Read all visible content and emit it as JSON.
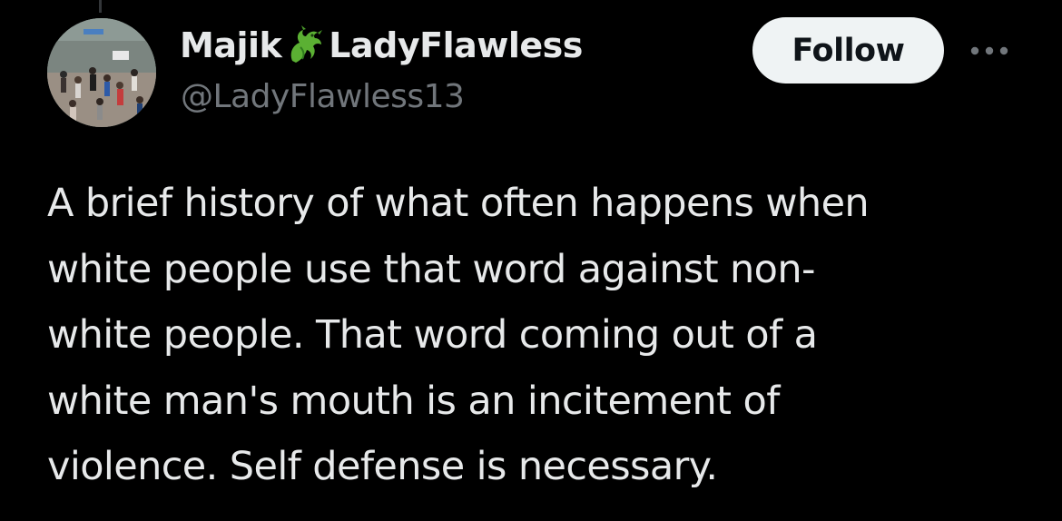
{
  "colors": {
    "background": "#000000",
    "text_primary": "#e7e9ea",
    "text_secondary": "#71767b",
    "follow_bg": "#eff3f4",
    "follow_text": "#0f1419",
    "emoji_green": "#5bb033"
  },
  "author": {
    "name_first": "Majik",
    "name_emoji": "dragon-emoji",
    "name_second": "LadyFlawless",
    "handle": "@LadyFlawless13",
    "avatar_icon": "avatar-photo-crowd"
  },
  "actions": {
    "follow_label": "Follow",
    "more_icon": "more-options-icon"
  },
  "tweet": {
    "lines": [
      "A brief history of what often happens when",
      "white people use that word against non-",
      "white people. That word coming out of a",
      "white man's mouth is an incitement of",
      "violence. Self defense is necessary."
    ]
  }
}
